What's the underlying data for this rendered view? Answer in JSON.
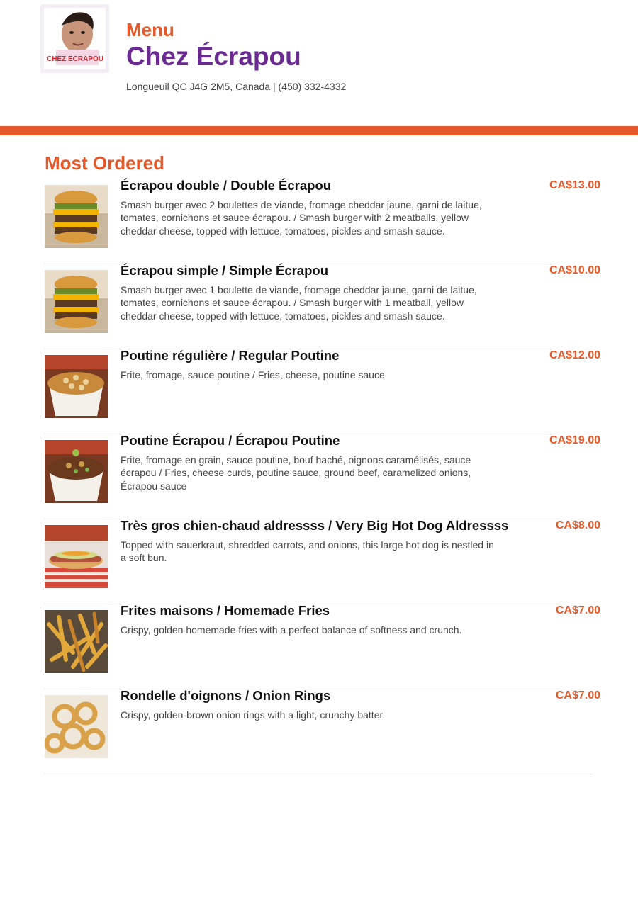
{
  "header": {
    "menu_label": "Menu",
    "restaurant_name": "Chez Écrapou",
    "address": "Longueuil QC J4G 2M5, Canada | (450) 332-4332",
    "logo_text": "CHEZ ECRAPOU"
  },
  "colors": {
    "accent": "#e5582a",
    "brand_purple": "#6a2a92"
  },
  "section": {
    "title": "Most Ordered"
  },
  "items": [
    {
      "name": "Écrapou double / Double Écrapou",
      "description": "Smash burger avec 2 boulettes de viande, fromage cheddar jaune, garni de laitue, tomates, cornichons et sauce écrapou. / Smash burger with 2 meatballs, yellow cheddar cheese, topped with lettuce, tomatoes, pickles and smash sauce.",
      "price": "CA$13.00",
      "image": "burger-photo"
    },
    {
      "name": "Écrapou simple / Simple Écrapou",
      "description": "Smash burger avec 1 boulette de viande, fromage cheddar jaune, garni de laitue, tomates, cornichons et sauce écrapou. / Smash burger with 1 meatball, yellow cheddar cheese, topped with lettuce, tomatoes, pickles and smash sauce.",
      "price": "CA$10.00",
      "image": "burger-photo"
    },
    {
      "name": "Poutine régulière / Regular Poutine",
      "description": "Frite, fromage, sauce poutine / Fries, cheese, poutine sauce",
      "price": "CA$12.00",
      "image": "poutine-photo"
    },
    {
      "name": "Poutine Écrapou / Écrapou Poutine",
      "description": "Frite, fromage en grain, sauce poutine, bouf haché, oignons caramélisés, sauce écrapou / Fries, cheese curds, poutine sauce, ground beef, caramelized onions, Écrapou sauce",
      "price": "CA$19.00",
      "image": "loaded-poutine-photo"
    },
    {
      "name": "Très gros chien-chaud aldressss / Very Big Hot Dog Aldressss",
      "description": "Topped with sauerkraut, shredded carrots, and onions, this large hot dog is nestled in a soft bun.",
      "price": "CA$8.00",
      "image": "hot-dog-photo"
    },
    {
      "name": "Frites maisons / Homemade Fries",
      "description": "Crispy, golden homemade fries with a perfect balance of softness and crunch.",
      "price": "CA$7.00",
      "image": "fries-photo"
    },
    {
      "name": "Rondelle d'oignons / Onion Rings",
      "description": "Crispy, golden-brown onion rings with a light, crunchy batter.",
      "price": "CA$7.00",
      "image": "onion-rings-photo"
    }
  ]
}
